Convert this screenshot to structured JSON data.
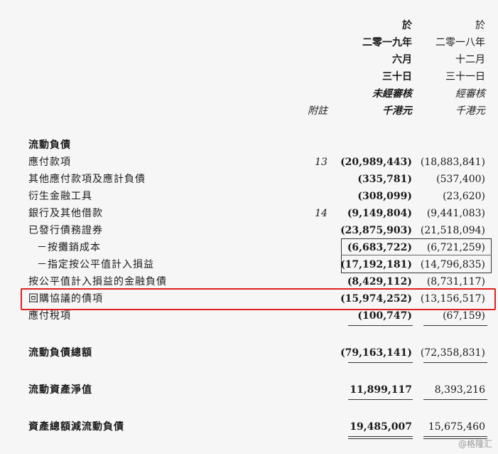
{
  "header": {
    "col1": [
      "於",
      "二零一九年",
      "六月",
      "三十日",
      "未經審核",
      "千港元"
    ],
    "col2": [
      "於",
      "二零一八年",
      "十二月",
      "三十一日",
      "經審核",
      "千港元"
    ],
    "note_label": "附註"
  },
  "section_title": "流動負債",
  "rows": [
    {
      "label": "應付款項",
      "note": "13",
      "v1": "(20,989,443)",
      "v2": "(18,883,841)"
    },
    {
      "label": "其他應付款項及應計負債",
      "note": "",
      "v1": "(335,781)",
      "v2": "(537,400)"
    },
    {
      "label": "衍生金融工具",
      "note": "",
      "v1": "(308,099)",
      "v2": "(23,620)"
    },
    {
      "label": "銀行及其他借款",
      "note": "14",
      "v1": "(9,149,804)",
      "v2": "(9,441,083)"
    },
    {
      "label": "已發行債務證券",
      "note": "",
      "v1": "(23,875,903)",
      "v2": "(21,518,094)"
    },
    {
      "label": "－按攤銷成本",
      "note": "",
      "v1": "(6,683,722)",
      "v2": "(6,721,259)"
    },
    {
      "label": "－指定按公平值計入損益",
      "note": "",
      "v1": "(17,192,181)",
      "v2": "(14,796,835)"
    },
    {
      "label": "按公平值計入損益的金融負債",
      "note": "",
      "v1": "(8,429,112)",
      "v2": "(8,731,117)"
    },
    {
      "label": "回購協議的債項",
      "note": "",
      "v1": "(15,974,252)",
      "v2": "(13,156,517)"
    },
    {
      "label": "應付稅項",
      "note": "",
      "v1": "(100,747)",
      "v2": "(67,159)"
    }
  ],
  "totals": [
    {
      "label": "流動負債總額",
      "v1": "(79,163,141)",
      "v2": "(72,358,831)"
    },
    {
      "label": "流動資產淨值",
      "v1": "11,899,117",
      "v2": "8,393,216"
    },
    {
      "label": "資產總額減流動負債",
      "v1": "19,485,007",
      "v2": "15,675,460"
    }
  ],
  "watermark": "@格隆汇",
  "colors": {
    "highlight": "#e02020",
    "text": "#1a1a1a",
    "background": "#f6f6f6"
  }
}
